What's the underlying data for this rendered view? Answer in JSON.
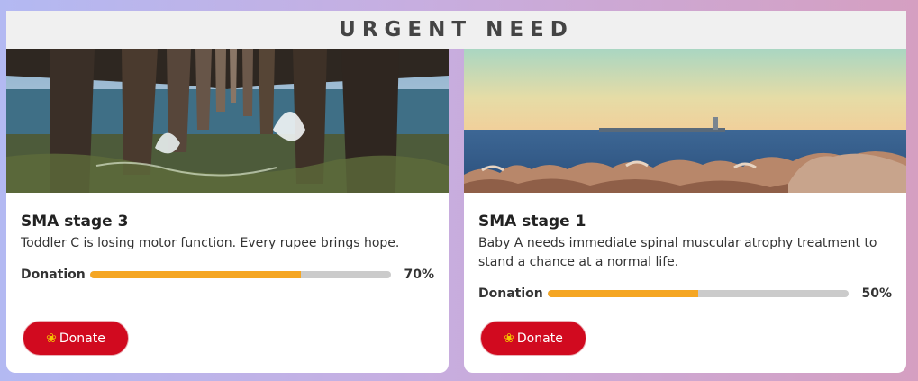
{
  "header": {
    "title": "URGENT NEED"
  },
  "cards": [
    {
      "title": "SMA stage 3",
      "description": "Toddler C is losing motor function. Every rupee brings hope.",
      "progress_label": "Donation",
      "progress_percent": 70,
      "progress_text": "70%",
      "button_label": "Donate",
      "button_icon": "hands-icon",
      "image": "pier-icon"
    },
    {
      "title": "SMA stage 1",
      "description": "Baby A needs immediate spinal muscular atrophy treatment to stand a chance at a normal life.",
      "progress_label": "Donation",
      "progress_percent": 50,
      "progress_text": "50%",
      "button_label": "Donate",
      "button_icon": "hands-icon",
      "image": "seashore-icon"
    }
  ],
  "colors": {
    "accent": "#f5a623",
    "button": "#d10a1f",
    "track": "#cbcbcb"
  }
}
